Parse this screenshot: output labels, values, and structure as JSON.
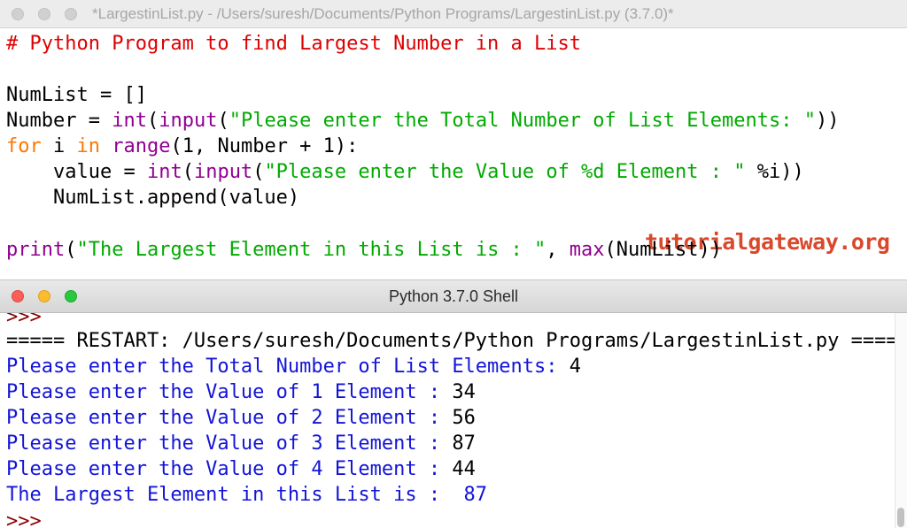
{
  "editor": {
    "title": "*LargestinList.py - /Users/suresh/Documents/Python Programs/LargestinList.py (3.7.0)*",
    "lines": [
      [
        {
          "t": "# Python Program to find Largest Number in a List",
          "c": "comment"
        }
      ],
      [],
      [
        {
          "t": "NumList = []",
          "c": "plain"
        }
      ],
      [
        {
          "t": "Number = ",
          "c": "plain"
        },
        {
          "t": "int",
          "c": "builtin"
        },
        {
          "t": "(",
          "c": "plain"
        },
        {
          "t": "input",
          "c": "builtin"
        },
        {
          "t": "(",
          "c": "plain"
        },
        {
          "t": "\"Please enter the Total Number of List Elements: \"",
          "c": "string"
        },
        {
          "t": "))",
          "c": "plain"
        }
      ],
      [
        {
          "t": "for",
          "c": "keyword"
        },
        {
          "t": " i ",
          "c": "plain"
        },
        {
          "t": "in",
          "c": "keyword"
        },
        {
          "t": " ",
          "c": "plain"
        },
        {
          "t": "range",
          "c": "builtin"
        },
        {
          "t": "(1, Number + 1):",
          "c": "plain"
        }
      ],
      [
        {
          "t": "    value = ",
          "c": "plain"
        },
        {
          "t": "int",
          "c": "builtin"
        },
        {
          "t": "(",
          "c": "plain"
        },
        {
          "t": "input",
          "c": "builtin"
        },
        {
          "t": "(",
          "c": "plain"
        },
        {
          "t": "\"Please enter the Value of %d Element : \"",
          "c": "string"
        },
        {
          "t": " %i))",
          "c": "plain"
        }
      ],
      [
        {
          "t": "    NumList.append(value)",
          "c": "plain"
        }
      ],
      [],
      [
        {
          "t": "print",
          "c": "builtin"
        },
        {
          "t": "(",
          "c": "plain"
        },
        {
          "t": "\"The Largest Element in this List is : \"",
          "c": "string"
        },
        {
          "t": ", ",
          "c": "plain"
        },
        {
          "t": "max",
          "c": "builtin"
        },
        {
          "t": "(NumList))",
          "c": "plain"
        }
      ]
    ]
  },
  "watermark": "tutorialgateway.org",
  "shell": {
    "title": "Python 3.7.0 Shell",
    "lines": [
      [
        {
          "t": ">>>",
          "c": "prompt"
        }
      ],
      [
        {
          "t": "===== RESTART: /Users/suresh/Documents/Python Programs/LargestinList.py =====",
          "c": "restart"
        }
      ],
      [
        {
          "t": "Please enter the Total Number of List Elements: ",
          "c": "blue"
        },
        {
          "t": "4",
          "c": "input"
        }
      ],
      [
        {
          "t": "Please enter the Value of 1 Element : ",
          "c": "blue"
        },
        {
          "t": "34",
          "c": "input"
        }
      ],
      [
        {
          "t": "Please enter the Value of 2 Element : ",
          "c": "blue"
        },
        {
          "t": "56",
          "c": "input"
        }
      ],
      [
        {
          "t": "Please enter the Value of 3 Element : ",
          "c": "blue"
        },
        {
          "t": "87",
          "c": "input"
        }
      ],
      [
        {
          "t": "Please enter the Value of 4 Element : ",
          "c": "blue"
        },
        {
          "t": "44",
          "c": "input"
        }
      ],
      [
        {
          "t": "The Largest Element in this List is :  87",
          "c": "blue"
        }
      ],
      [
        {
          "t": ">>>",
          "c": "prompt"
        }
      ]
    ]
  },
  "colors": {
    "comment": "#dd0000",
    "keyword": "#ff7700",
    "builtin": "#900090",
    "string": "#00aa00",
    "shell_output": "#1414d8",
    "prompt": "#8b0000",
    "watermark": "#d9482b"
  }
}
